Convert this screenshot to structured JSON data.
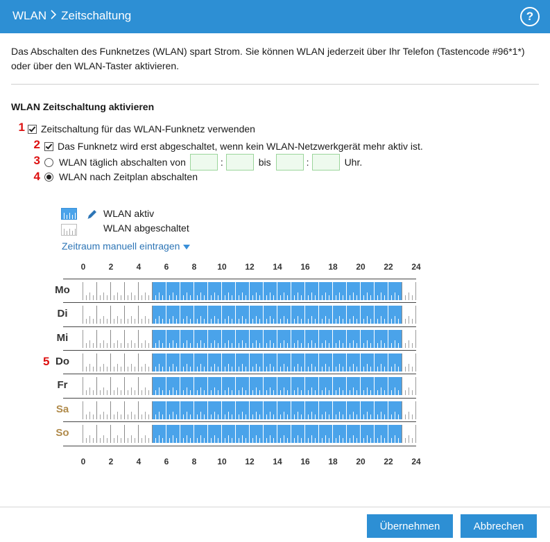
{
  "header": {
    "crumb_root": "WLAN",
    "crumb_page": "Zeitschaltung",
    "help_label": "?"
  },
  "intro": "Das Abschalten des Funknetzes (WLAN) spart Strom. Sie können WLAN jederzeit über Ihr Telefon (Tastencode #96*1*) oder über den WLAN-Taster aktivieren.",
  "section_title": "WLAN Zeitschaltung aktivieren",
  "options": {
    "use_timer": {
      "num": "1",
      "label": "Zeitschaltung für das WLAN-Funknetz verwenden",
      "checked": true
    },
    "wait_inactive": {
      "num": "2",
      "label": "Das Funknetz wird erst abgeschaltet, wenn kein WLAN-Netzwerkgerät mehr aktiv ist.",
      "checked": true
    },
    "daily": {
      "num": "3",
      "label": "WLAN täglich abschalten von",
      "bis": "bis",
      "uhr": "Uhr.",
      "colon": ":",
      "selected": false
    },
    "schedule": {
      "num": "4",
      "label": "WLAN nach Zeitplan abschalten",
      "selected": true
    }
  },
  "legend": {
    "active": "WLAN aktiv",
    "off": "WLAN abgeschaltet",
    "manual_link": "Zeitraum manuell eintragen"
  },
  "schedule": {
    "marker": "5",
    "hour_labels": [
      "0",
      "2",
      "4",
      "6",
      "8",
      "10",
      "12",
      "14",
      "16",
      "18",
      "20",
      "22",
      "24"
    ],
    "days": [
      {
        "label": "Mo",
        "weekend": false,
        "active_from": 5,
        "active_to": 23
      },
      {
        "label": "Di",
        "weekend": false,
        "active_from": 5,
        "active_to": 23
      },
      {
        "label": "Mi",
        "weekend": false,
        "active_from": 5,
        "active_to": 23
      },
      {
        "label": "Do",
        "weekend": false,
        "active_from": 5,
        "active_to": 23
      },
      {
        "label": "Fr",
        "weekend": false,
        "active_from": 5,
        "active_to": 23
      },
      {
        "label": "Sa",
        "weekend": true,
        "active_from": 5,
        "active_to": 23
      },
      {
        "label": "So",
        "weekend": true,
        "active_from": 5,
        "active_to": 23
      }
    ]
  },
  "colors": {
    "accent": "#2d8fd4",
    "active": "#4aa3ea",
    "marker": "#dd1111",
    "weekend": "#b08a4a"
  },
  "buttons": {
    "apply": "Übernehmen",
    "cancel": "Abbrechen"
  }
}
